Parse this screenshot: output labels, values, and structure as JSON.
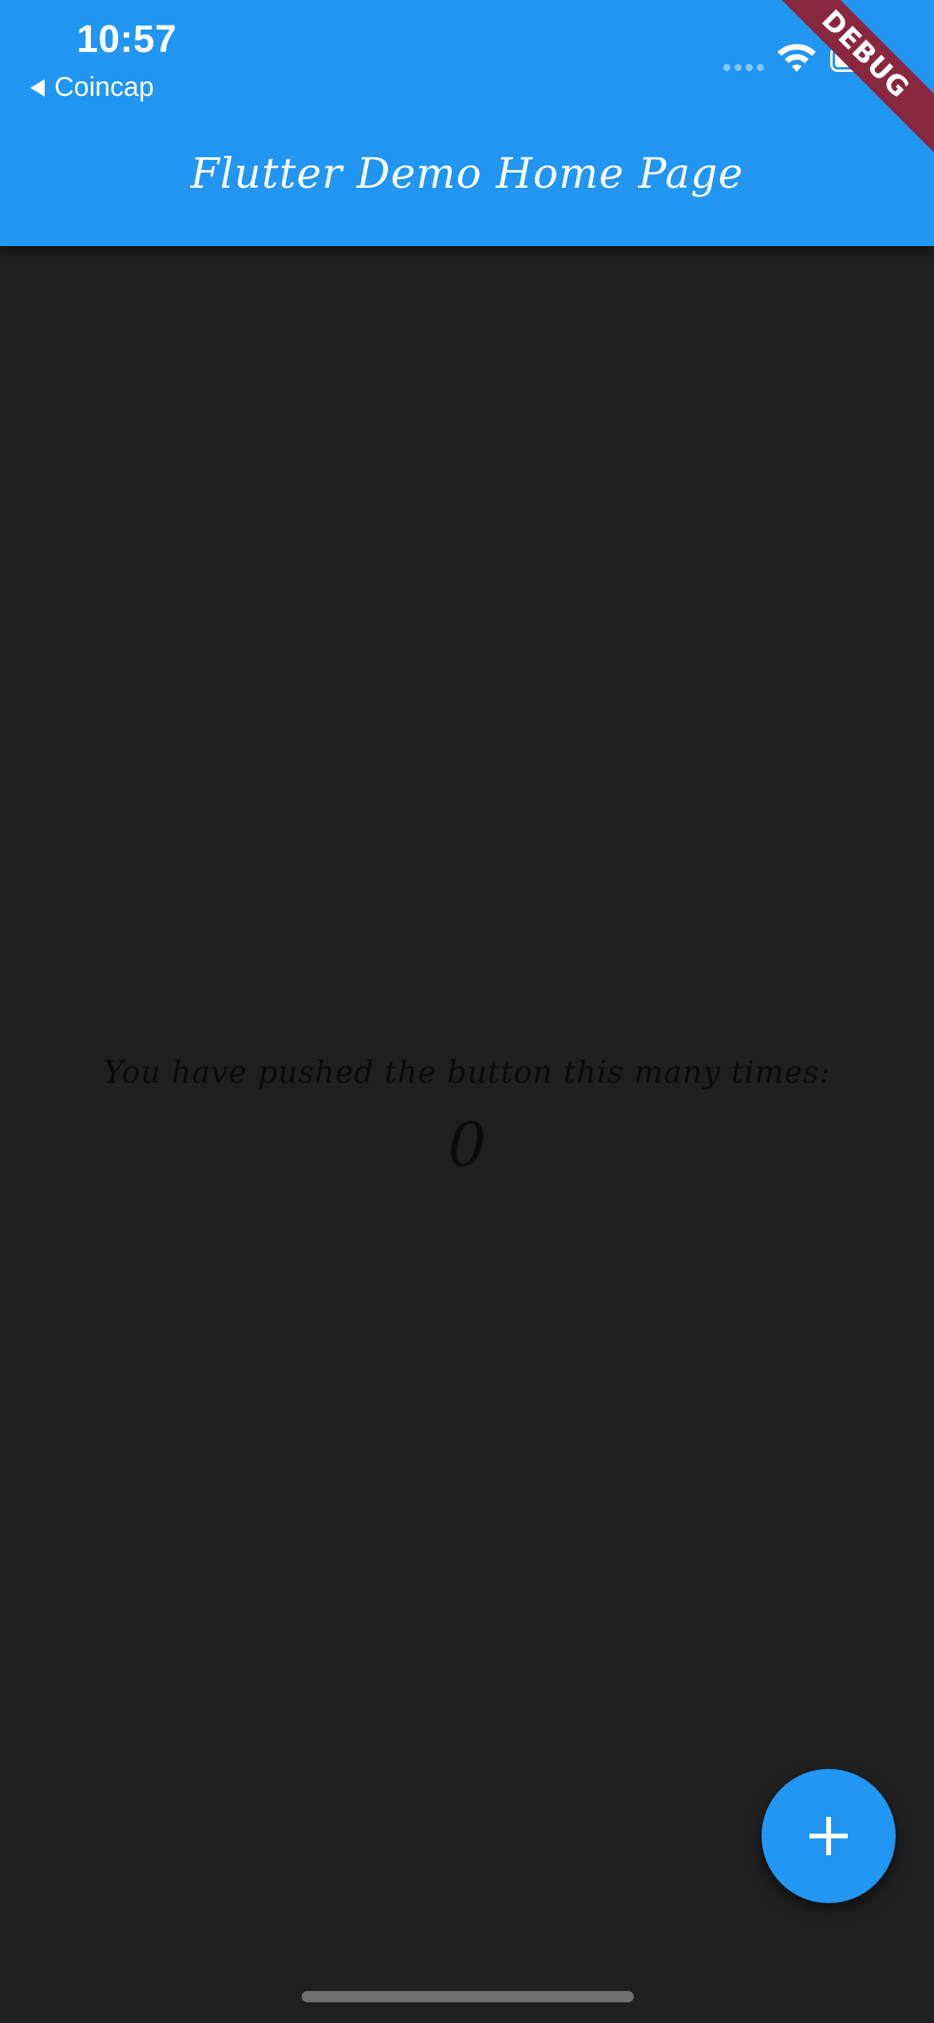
{
  "status_bar": {
    "time": "10:57",
    "back_app_label": "Coincap",
    "icons": [
      "cellular-signal-icon",
      "wifi-icon",
      "battery-icon"
    ]
  },
  "app_bar": {
    "title": "Flutter Demo Home Page",
    "background_color": "#2196f3"
  },
  "debug_banner": {
    "label": "DEBUG",
    "color": "#8a2740"
  },
  "body": {
    "background_color": "#1f1f1f",
    "caption": "You have pushed the button this many times:",
    "counter_value": "0"
  },
  "fab": {
    "icon": "plus-icon",
    "color": "#2196f3"
  }
}
